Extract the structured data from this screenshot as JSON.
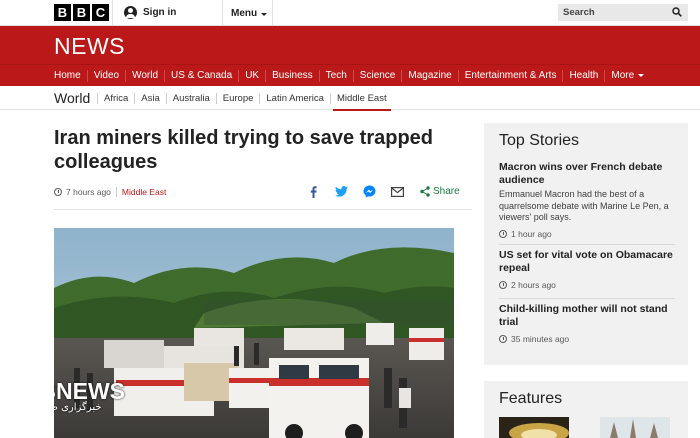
{
  "header": {
    "logo_letters": [
      "B",
      "B",
      "C"
    ],
    "signin_label": "Sign in",
    "menu_label": "Menu",
    "search_placeholder": "Search"
  },
  "banner": {
    "title": "NEWS"
  },
  "nav": {
    "items": [
      "Home",
      "Video",
      "World",
      "US & Canada",
      "UK",
      "Business",
      "Tech",
      "Science",
      "Magazine",
      "Entertainment & Arts",
      "Health"
    ],
    "more_label": "More"
  },
  "subnav": {
    "title": "World",
    "items": [
      "Africa",
      "Asia",
      "Australia",
      "Europe",
      "Latin America",
      "Middle East"
    ],
    "active": "Middle East"
  },
  "article": {
    "headline": "Iran miners killed trying to save trapped colleagues",
    "time": "7 hours ago",
    "section": "Middle East",
    "share_label": "Share"
  },
  "watermark": {
    "brand": "IRIBNEWS",
    "tagline": "خبرگزاری صدا و سیما"
  },
  "sidebar": {
    "heading": "Top Stories",
    "stories": [
      {
        "title": "Macron wins over French debate audience",
        "summary": "Emmanuel Macron had the best of a quarrelsome debate with Marine Le Pen, a viewers' poll says.",
        "time": "1 hour ago"
      },
      {
        "title": "US set for vital vote on Obamacare repeal",
        "time": "2 hours ago"
      },
      {
        "title": "Child-killing mother will not stand trial",
        "time": "35 minutes ago"
      }
    ],
    "features_heading": "Features"
  },
  "colors": {
    "brand_red": "#bb1919",
    "share_green": "#1a7d3b",
    "facebook": "#3b5998",
    "twitter": "#1da1f2",
    "messenger": "#0084ff"
  }
}
